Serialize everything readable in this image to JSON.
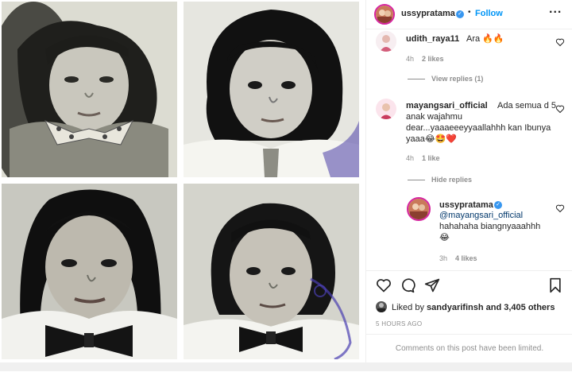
{
  "header": {
    "username": "ussypratama",
    "follow_label": "Follow",
    "dot": "•",
    "more": "..."
  },
  "comments": [
    {
      "username": "udith_raya11",
      "text": "Ara 🔥🔥",
      "time": "4h",
      "likes": "2 likes",
      "view_replies": "View replies (1)"
    },
    {
      "username": "mayangsari_official",
      "text_lines": [
        "Ada semua d 5",
        "anak wajahmu",
        "dear...yaaaeeeyyaallahhh kan Ibunya",
        "yaaa😂🤩❤️"
      ],
      "time": "4h",
      "likes": "1 like",
      "hide_replies": "Hide replies"
    }
  ],
  "reply": {
    "username": "ussypratama",
    "mention": "@mayangsari_official",
    "text": "hahahaha biangnyaaahhh",
    "emoji": "😂",
    "time": "3h",
    "likes": "4 likes"
  },
  "likes": {
    "prefix": "Liked by ",
    "user": "sandyarifinsh",
    "suffix": " and 3,405 others"
  },
  "timestamp": "5 HOURS AGO",
  "limited": "Comments on this post have been limited."
}
